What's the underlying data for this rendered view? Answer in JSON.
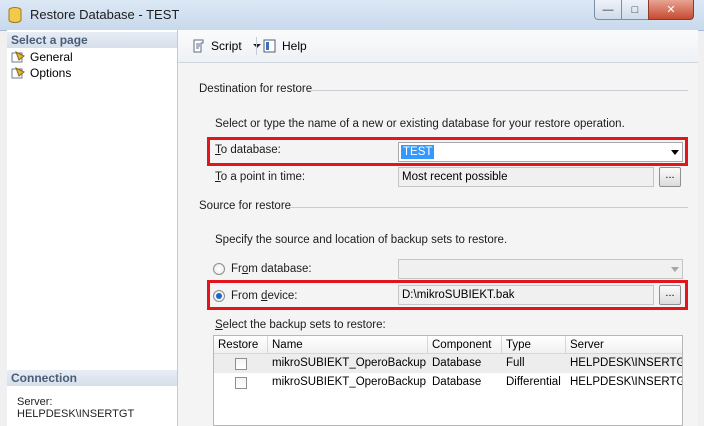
{
  "window": {
    "title": "Restore Database - TEST",
    "controls": {
      "minimize": "—",
      "maximize": "□",
      "close": "✕"
    }
  },
  "sidebar": {
    "select_page_header": "Select a page",
    "items": [
      {
        "label": "General",
        "icon": "page-settings-icon"
      },
      {
        "label": "Options",
        "icon": "page-settings-icon"
      }
    ],
    "connection_header": "Connection",
    "server_label": "Server:",
    "server_value": "HELPDESK\\INSERTGT"
  },
  "toolbar": {
    "script_label": "Script",
    "help_label": "Help"
  },
  "destination": {
    "group_title": "Destination for restore",
    "instruction": "Select or type the name of a new or existing database for your restore operation.",
    "to_database_label_prefix": "T",
    "to_database_label_rest": "o database:",
    "to_database_value": "TEST",
    "point_in_time_label_prefix": "T",
    "point_in_time_label_rest": "o a point in time:",
    "point_in_time_value": "Most recent possible",
    "browse_button": "..."
  },
  "source": {
    "group_title": "Source for restore",
    "instruction": "Specify the source and location of backup sets to restore.",
    "from_database_label_pre": "Fr",
    "from_database_label_u": "o",
    "from_database_label_post": "m database:",
    "from_database_value": "",
    "from_device_label_pre": "From ",
    "from_device_label_u": "d",
    "from_device_label_post": "evice:",
    "from_device_value": "D:\\mikroSUBIEKT.bak",
    "browse_button": "...",
    "selected": "from_device"
  },
  "backup_sets": {
    "label_u": "S",
    "label_rest": "elect the backup sets to restore:",
    "columns": [
      "Restore",
      "Name",
      "Component",
      "Type",
      "Server"
    ],
    "rows": [
      {
        "restore": false,
        "name": "mikroSUBIEKT_OperoBackup",
        "component": "Database",
        "type": "Full",
        "server": "HELPDESK\\INSERTGT"
      },
      {
        "restore": false,
        "name": "mikroSUBIEKT_OperoBackup",
        "component": "Database",
        "type": "Differential",
        "server": "HELPDESK\\INSERTGT"
      }
    ]
  },
  "colors": {
    "highlight_box": "#e2141c",
    "selection": "#3399ff"
  }
}
